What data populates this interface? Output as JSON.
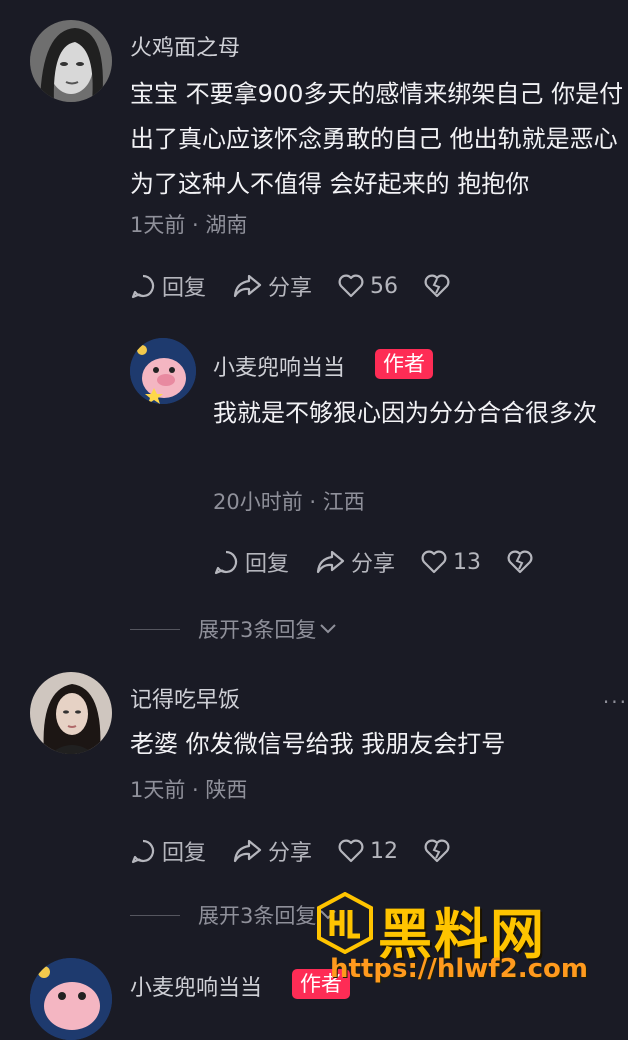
{
  "comments": [
    {
      "username": "火鸡面之母",
      "text": "宝宝 不要拿900多天的感情来绑架自己 你是付出了真心应该怀念勇敢的自己 他出轨就是恶心 为了这种人不值得 会好起来的 抱抱你",
      "meta": "1天前 · 湖南",
      "reply_label": "回复",
      "share_label": "分享",
      "likes": "56"
    },
    {
      "username": "小麦兜响当当",
      "badge": "作者",
      "text": "我就是不够狠心因为分分合合很多次",
      "meta": "20小时前 · 江西",
      "reply_label": "回复",
      "share_label": "分享",
      "likes": "13"
    },
    {
      "username": "记得吃早饭",
      "text": "老婆 你发微信号给我 我朋友会打号",
      "meta": "1天前 · 陕西",
      "reply_label": "回复",
      "share_label": "分享",
      "likes": "12"
    },
    {
      "username": "小麦兜响当当",
      "badge": "作者"
    }
  ],
  "expand_replies": [
    "展开3条回复",
    "展开3条回复"
  ],
  "more_icon": "···",
  "watermark": {
    "brand": "黑料网",
    "url": "https://hlwf2.com"
  },
  "colors": {
    "background": "#1a1b25",
    "badge": "#fe2c55",
    "watermark": "#ffc400"
  }
}
